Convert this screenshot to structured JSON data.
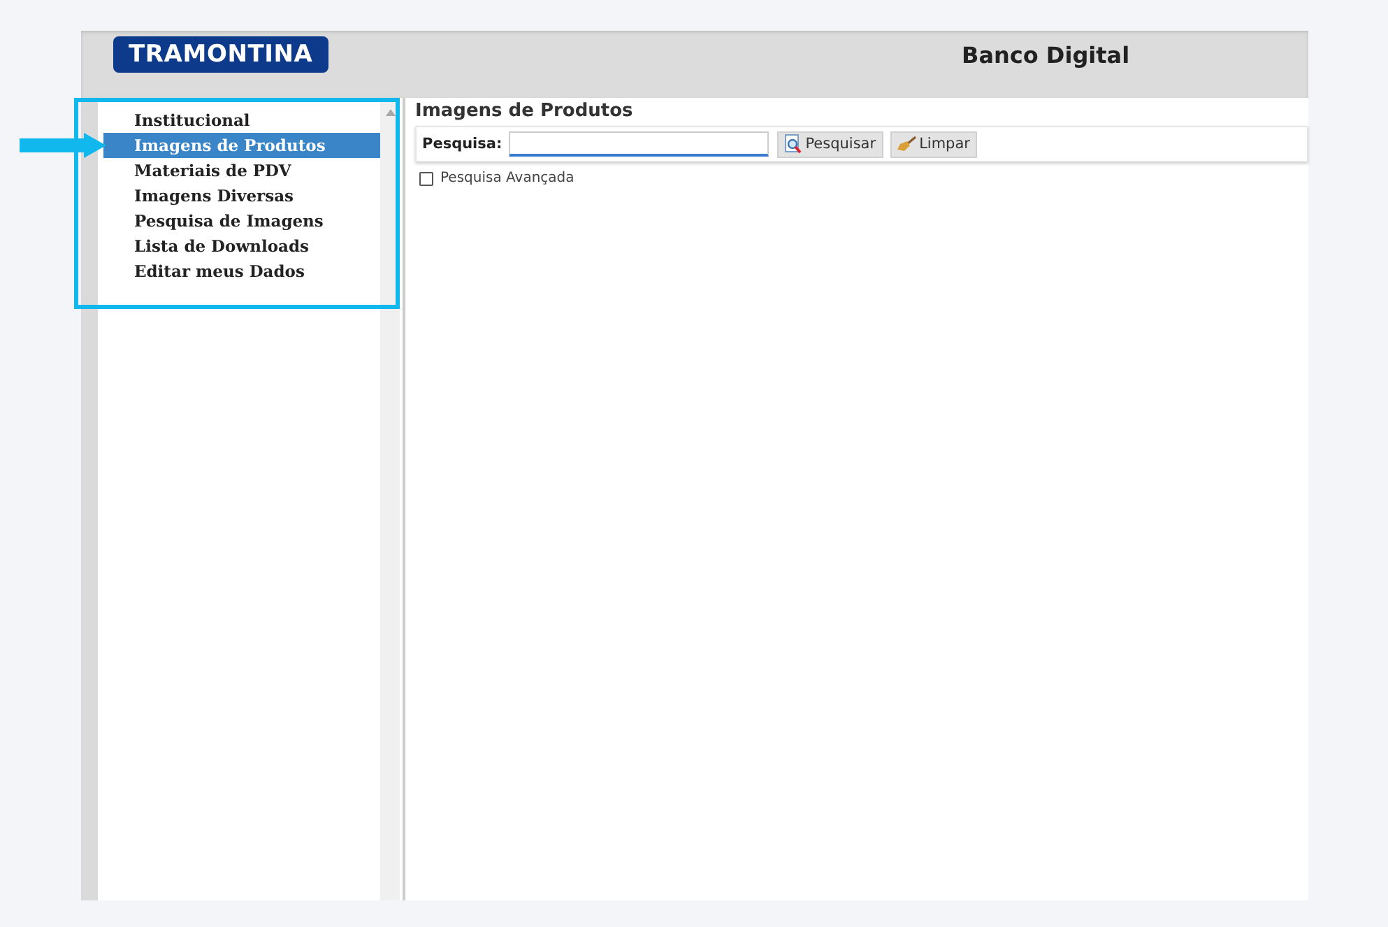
{
  "header": {
    "logo": "TRAMONTINA",
    "title": "Banco Digital"
  },
  "sidebar": {
    "items": [
      {
        "label": "Institucional",
        "selected": false
      },
      {
        "label": "Imagens de Produtos",
        "selected": true
      },
      {
        "label": "Materiais de PDV",
        "selected": false
      },
      {
        "label": "Imagens Diversas",
        "selected": false
      },
      {
        "label": "Pesquisa de Imagens",
        "selected": false
      },
      {
        "label": "Lista de Downloads",
        "selected": false
      },
      {
        "label": "Editar meus Dados",
        "selected": false
      }
    ]
  },
  "main": {
    "title": "Imagens de Produtos",
    "search": {
      "label": "Pesquisa:"
    },
    "buttons": [
      "Pesquisar",
      "Limpar"
    ],
    "advanced": {
      "label": "Pesquisa Avançada",
      "checked": false
    }
  }
}
